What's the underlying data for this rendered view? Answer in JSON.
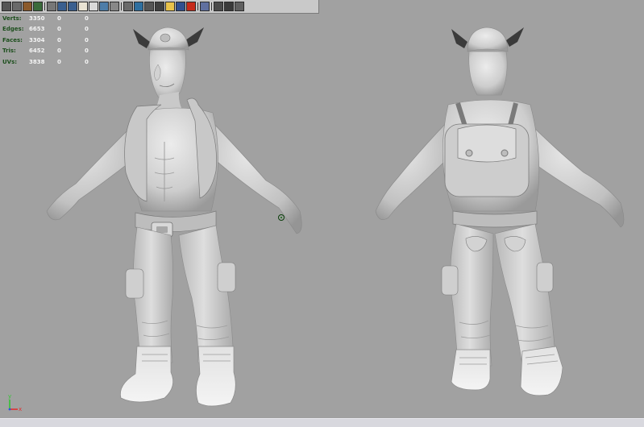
{
  "toolbar": {
    "tools": [
      {
        "icon": "camera-select-icon",
        "color": "#555555"
      },
      {
        "icon": "camera-list-icon",
        "color": "#6a6a6a"
      },
      {
        "icon": "bookmark-icon",
        "color": "#8b5a2b"
      },
      {
        "icon": "image-plane-icon",
        "color": "#3b6b3b"
      },
      {
        "icon": "separator"
      },
      {
        "icon": "grid-icon",
        "color": "#777777"
      },
      {
        "icon": "film-gate-icon",
        "color": "#3a5f8f"
      },
      {
        "icon": "resolution-gate-icon",
        "color": "#3a5f8f"
      },
      {
        "icon": "safe-action-icon",
        "color": "#e9e3d3"
      },
      {
        "icon": "wireframe-icon",
        "color": "#d9d9d9"
      },
      {
        "icon": "smooth-shade-icon",
        "color": "#4d7da8"
      },
      {
        "icon": "shade-wireframe-icon",
        "color": "#888888"
      },
      {
        "icon": "separator"
      },
      {
        "icon": "default-material-icon",
        "color": "#6a6a6a"
      },
      {
        "icon": "textured-icon",
        "color": "#2f6f9f"
      },
      {
        "icon": "lighting-icon",
        "color": "#555555"
      },
      {
        "icon": "shadows-icon",
        "color": "#3f3f3f"
      },
      {
        "icon": "light-bulb-icon",
        "color": "#e8c24a"
      },
      {
        "icon": "isolate-icon",
        "color": "#2f4f8f"
      },
      {
        "icon": "xray-icon",
        "color": "#c62a1a"
      },
      {
        "icon": "separator"
      },
      {
        "icon": "frame-icon",
        "color": "#6070a0"
      },
      {
        "icon": "separator"
      },
      {
        "icon": "hud-icon",
        "color": "#4a4a4a"
      },
      {
        "icon": "render-view-icon",
        "color": "#3a3a3a"
      },
      {
        "icon": "sculpt-icon",
        "color": "#606060"
      }
    ]
  },
  "hud": {
    "rows": [
      {
        "label": "Verts:",
        "v1": "3350",
        "v2": "0",
        "v3": "0"
      },
      {
        "label": "Edges:",
        "v1": "6653",
        "v2": "0",
        "v3": "0"
      },
      {
        "label": "Faces:",
        "v1": "3304",
        "v2": "0",
        "v3": "0"
      },
      {
        "label": "Tris:",
        "v1": "6452",
        "v2": "0",
        "v3": "0"
      },
      {
        "label": "UVs:",
        "v1": "3838",
        "v2": "0",
        "v3": "0"
      }
    ]
  },
  "axis": {
    "y": "y",
    "x": "x",
    "y_color": "#35c435",
    "x_color": "#e03030",
    "z_color": "#3050e0"
  },
  "colors": {
    "viewport_bg": "#a1a1a1",
    "model_light": "#e4e4e4",
    "model_mid": "#c4c4c4",
    "model_shadow": "#8a8a8a",
    "horn": "#3a3a3a"
  }
}
